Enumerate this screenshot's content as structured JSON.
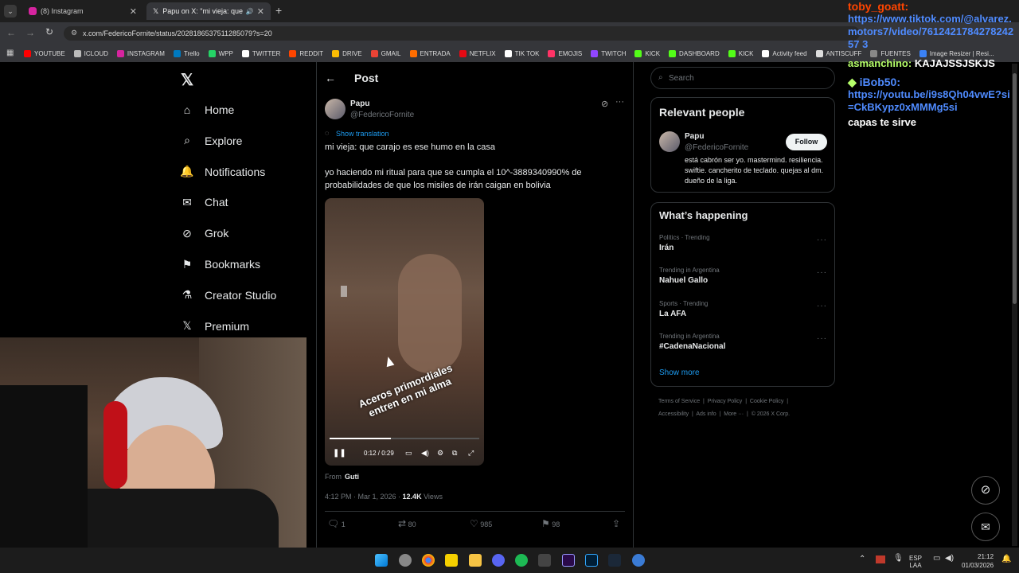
{
  "browser": {
    "tabs": [
      {
        "label": "(8) Instagram"
      },
      {
        "label": "Papu on X: \"mi vieja: que ca"
      }
    ],
    "url": "x.com/FedericoFornite/status/2028186537511285079?s=20",
    "bookmarks": [
      "YOUTUBE",
      "ICLOUD",
      "INSTAGRAM",
      "Trello",
      "WPP",
      "TWITTER",
      "REDDIT",
      "DRIVE",
      "GMAIL",
      "ENTRADA",
      "NETFLIX",
      "TIK TOK",
      "EMOJIS",
      "TWITCH",
      "KICK",
      "DASHBOARD",
      "KICK",
      "Activity feed",
      "ANTISCUFF",
      "FUENTES",
      "Image Resizer | Resi..."
    ],
    "bookmark_colors": [
      "#ff0000",
      "#bbbbbb",
      "#d6249f",
      "#0079bf",
      "#25d366",
      "#ffffff",
      "#ff4500",
      "#fbbc04",
      "#ea4335",
      "#ff6d00",
      "#e50914",
      "#ffffff",
      "#ff3366",
      "#9146ff",
      "#53fc18",
      "#53fc18",
      "#53fc18",
      "#ffffff",
      "#dddddd",
      "#888888",
      "#3b82f6"
    ]
  },
  "sidebar": {
    "items": [
      {
        "label": "Home",
        "icon": "home-icon"
      },
      {
        "label": "Explore",
        "icon": "search-icon"
      },
      {
        "label": "Notifications",
        "icon": "bell-icon"
      },
      {
        "label": "Chat",
        "icon": "mail-icon"
      },
      {
        "label": "Grok",
        "icon": "grok-icon"
      },
      {
        "label": "Bookmarks",
        "icon": "bookmark-icon"
      },
      {
        "label": "Creator Studio",
        "icon": "flask-icon"
      },
      {
        "label": "Premium",
        "icon": "x-logo-icon"
      }
    ]
  },
  "post": {
    "header_title": "Post",
    "author_name": "Papu",
    "author_handle": "@FedericoFornite",
    "show_translation": "Show translation",
    "text_line1": "mi vieja: que carajo es ese humo en la casa",
    "text_line2": "yo haciendo mi ritual para que se cumpla el 10^-3889340990% de",
    "text_line3": "probabilidades de que los misiles de irán caigan en bolivia",
    "video_caption": "Aceros primordiales entren en mi alma",
    "video_time": "0:12 / 0:29",
    "video_progress": 0.41,
    "from_label": "From",
    "from_user": "Guti",
    "timestamp": "4:12 PM · Mar 1, 2026 · ",
    "views_count": "12.4K",
    "views_label": "Views",
    "replies": "1",
    "reposts": "80",
    "likes": "985",
    "bookmarks": "98"
  },
  "right": {
    "search_placeholder": "Search",
    "relevant_title": "Relevant people",
    "person_name": "Papu",
    "person_handle": "@FedericoFornite",
    "follow_label": "Follow",
    "person_bio": "está cabrón ser yo. mastermind. resiliencia. swiftie. cancherito de teclado. quejas al dm. dueño de la liga.",
    "happening_title": "What’s happening",
    "trends": [
      {
        "context": "Politics · Trending",
        "topic": "Irán"
      },
      {
        "context": "Trending in Argentina",
        "topic": "Nahuel Gallo"
      },
      {
        "context": "Sports · Trending",
        "topic": "La AFA"
      },
      {
        "context": "Trending in Argentina",
        "topic": "#CadenaNacional"
      }
    ],
    "show_more": "Show more",
    "footer_line1": [
      "Terms of Service",
      "Privacy Policy",
      "Cookie Policy"
    ],
    "footer_line2": [
      "Accessibility",
      "Ads info",
      "More ···",
      "© 2026 X Corp."
    ]
  },
  "chat": [
    {
      "user": "toby_goatt:",
      "msg": "https://www.tiktok.com/@alvarez.motors7/video/761242178427824257 3",
      "user_color": "#ff4500",
      "msg_color": "#4f8bff"
    },
    {
      "user": "asmanchino:",
      "msg": "KAJAJSSJSKJS",
      "user_color": "#b6ff6a",
      "msg_color": "#ffffff"
    },
    {
      "user": "iBob50:",
      "msg": "https://youtu.be/i9s8Qh04vwE?si=CkBKypz0xMMMg5si",
      "user_color": "#4f8bff",
      "msg_color": "#4f8bff"
    },
    {
      "user": "",
      "msg": "capas te sirve",
      "user_color": "#ffffff",
      "msg_color": "#ffffff"
    }
  ],
  "taskbar": {
    "lang_line1": "ESP",
    "lang_line2": "LAA",
    "time": "21:12",
    "date": "01/03/2026"
  }
}
